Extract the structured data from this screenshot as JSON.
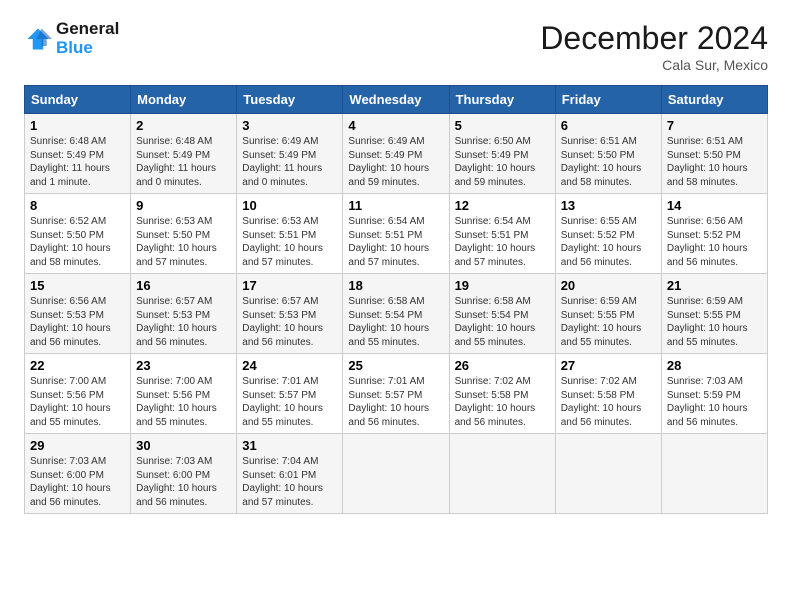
{
  "header": {
    "logo_line1": "General",
    "logo_line2": "Blue",
    "month": "December 2024",
    "location": "Cala Sur, Mexico"
  },
  "weekdays": [
    "Sunday",
    "Monday",
    "Tuesday",
    "Wednesday",
    "Thursday",
    "Friday",
    "Saturday"
  ],
  "weeks": [
    [
      {
        "day": "1",
        "info": "Sunrise: 6:48 AM\nSunset: 5:49 PM\nDaylight: 11 hours\nand 1 minute."
      },
      {
        "day": "2",
        "info": "Sunrise: 6:48 AM\nSunset: 5:49 PM\nDaylight: 11 hours\nand 0 minutes."
      },
      {
        "day": "3",
        "info": "Sunrise: 6:49 AM\nSunset: 5:49 PM\nDaylight: 11 hours\nand 0 minutes."
      },
      {
        "day": "4",
        "info": "Sunrise: 6:49 AM\nSunset: 5:49 PM\nDaylight: 10 hours\nand 59 minutes."
      },
      {
        "day": "5",
        "info": "Sunrise: 6:50 AM\nSunset: 5:49 PM\nDaylight: 10 hours\nand 59 minutes."
      },
      {
        "day": "6",
        "info": "Sunrise: 6:51 AM\nSunset: 5:50 PM\nDaylight: 10 hours\nand 58 minutes."
      },
      {
        "day": "7",
        "info": "Sunrise: 6:51 AM\nSunset: 5:50 PM\nDaylight: 10 hours\nand 58 minutes."
      }
    ],
    [
      {
        "day": "8",
        "info": "Sunrise: 6:52 AM\nSunset: 5:50 PM\nDaylight: 10 hours\nand 58 minutes."
      },
      {
        "day": "9",
        "info": "Sunrise: 6:53 AM\nSunset: 5:50 PM\nDaylight: 10 hours\nand 57 minutes."
      },
      {
        "day": "10",
        "info": "Sunrise: 6:53 AM\nSunset: 5:51 PM\nDaylight: 10 hours\nand 57 minutes."
      },
      {
        "day": "11",
        "info": "Sunrise: 6:54 AM\nSunset: 5:51 PM\nDaylight: 10 hours\nand 57 minutes."
      },
      {
        "day": "12",
        "info": "Sunrise: 6:54 AM\nSunset: 5:51 PM\nDaylight: 10 hours\nand 57 minutes."
      },
      {
        "day": "13",
        "info": "Sunrise: 6:55 AM\nSunset: 5:52 PM\nDaylight: 10 hours\nand 56 minutes."
      },
      {
        "day": "14",
        "info": "Sunrise: 6:56 AM\nSunset: 5:52 PM\nDaylight: 10 hours\nand 56 minutes."
      }
    ],
    [
      {
        "day": "15",
        "info": "Sunrise: 6:56 AM\nSunset: 5:53 PM\nDaylight: 10 hours\nand 56 minutes."
      },
      {
        "day": "16",
        "info": "Sunrise: 6:57 AM\nSunset: 5:53 PM\nDaylight: 10 hours\nand 56 minutes."
      },
      {
        "day": "17",
        "info": "Sunrise: 6:57 AM\nSunset: 5:53 PM\nDaylight: 10 hours\nand 56 minutes."
      },
      {
        "day": "18",
        "info": "Sunrise: 6:58 AM\nSunset: 5:54 PM\nDaylight: 10 hours\nand 55 minutes."
      },
      {
        "day": "19",
        "info": "Sunrise: 6:58 AM\nSunset: 5:54 PM\nDaylight: 10 hours\nand 55 minutes."
      },
      {
        "day": "20",
        "info": "Sunrise: 6:59 AM\nSunset: 5:55 PM\nDaylight: 10 hours\nand 55 minutes."
      },
      {
        "day": "21",
        "info": "Sunrise: 6:59 AM\nSunset: 5:55 PM\nDaylight: 10 hours\nand 55 minutes."
      }
    ],
    [
      {
        "day": "22",
        "info": "Sunrise: 7:00 AM\nSunset: 5:56 PM\nDaylight: 10 hours\nand 55 minutes."
      },
      {
        "day": "23",
        "info": "Sunrise: 7:00 AM\nSunset: 5:56 PM\nDaylight: 10 hours\nand 55 minutes."
      },
      {
        "day": "24",
        "info": "Sunrise: 7:01 AM\nSunset: 5:57 PM\nDaylight: 10 hours\nand 55 minutes."
      },
      {
        "day": "25",
        "info": "Sunrise: 7:01 AM\nSunset: 5:57 PM\nDaylight: 10 hours\nand 56 minutes."
      },
      {
        "day": "26",
        "info": "Sunrise: 7:02 AM\nSunset: 5:58 PM\nDaylight: 10 hours\nand 56 minutes."
      },
      {
        "day": "27",
        "info": "Sunrise: 7:02 AM\nSunset: 5:58 PM\nDaylight: 10 hours\nand 56 minutes."
      },
      {
        "day": "28",
        "info": "Sunrise: 7:03 AM\nSunset: 5:59 PM\nDaylight: 10 hours\nand 56 minutes."
      }
    ],
    [
      {
        "day": "29",
        "info": "Sunrise: 7:03 AM\nSunset: 6:00 PM\nDaylight: 10 hours\nand 56 minutes."
      },
      {
        "day": "30",
        "info": "Sunrise: 7:03 AM\nSunset: 6:00 PM\nDaylight: 10 hours\nand 56 minutes."
      },
      {
        "day": "31",
        "info": "Sunrise: 7:04 AM\nSunset: 6:01 PM\nDaylight: 10 hours\nand 57 minutes."
      },
      null,
      null,
      null,
      null
    ]
  ]
}
